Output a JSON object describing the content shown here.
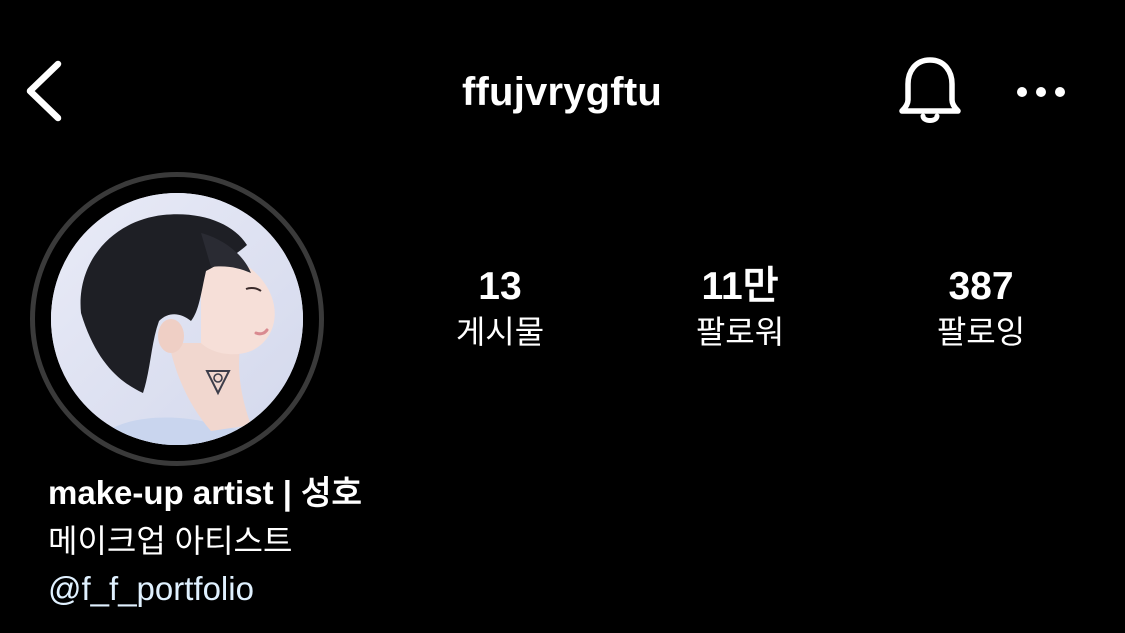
{
  "header": {
    "username": "ffujvrygftu",
    "back_icon": "chevron-left-icon",
    "notification_icon": "bell-icon",
    "more_icon": "more-horizontal-icon"
  },
  "profile": {
    "avatar_icon": "profile-photo"
  },
  "stats": [
    {
      "value": "13",
      "label": "게시물"
    },
    {
      "value": "11만",
      "label": "팔로워"
    },
    {
      "value": "387",
      "label": "팔로잉"
    }
  ],
  "bio": {
    "name": "make-up artist | 성호",
    "text": "메이크업 아티스트",
    "link": "@f_f_portfolio"
  },
  "colors": {
    "background": "#000000",
    "text": "#ffffff",
    "link": "#e0f1ff",
    "avatar_ring": "#3a3a3a"
  }
}
